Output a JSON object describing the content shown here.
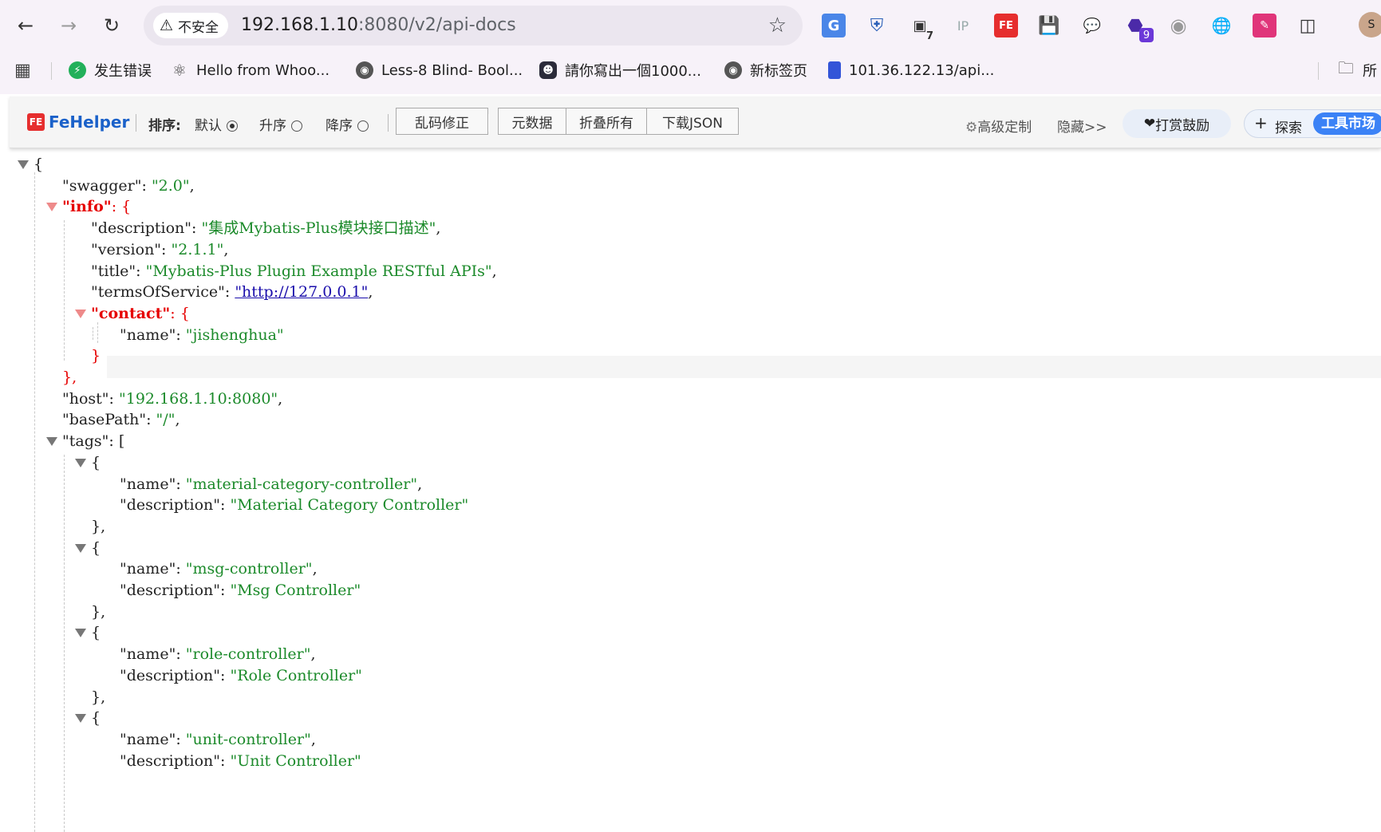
{
  "browser": {
    "security_label": "不安全",
    "url_host": "192.168.1.10",
    "url_rest": ":8080/v2/api-docs",
    "ext_badge_7": "7",
    "ext_badge_9": "9",
    "profile_initial": "S",
    "bookmarks": [
      {
        "label": "发生错误"
      },
      {
        "label": "Hello from Whoo..."
      },
      {
        "label": "Less-8 Blind- Bool..."
      },
      {
        "label": "請你寫出一個1000..."
      },
      {
        "label": "新标签页"
      },
      {
        "label": "101.36.122.13/api..."
      },
      {
        "label": "所"
      }
    ]
  },
  "fehelper": {
    "logo_text": "FeHelper",
    "sort_label": "排序:",
    "sort_default": "默认",
    "sort_asc": "升序",
    "sort_desc": "降序",
    "fix_encoding": "乱码修正",
    "metadata": "元数据",
    "fold_all": "折叠所有",
    "download_json": "下载JSON",
    "advanced": "高级定制",
    "hide": "隐藏>>",
    "donate": "打赏鼓励",
    "explore": "探索",
    "tool_market": "工具市场"
  },
  "json_lines": [
    {
      "p": "{"
    },
    {
      "k": "swagger",
      "v": "2.0",
      "c": ","
    },
    {
      "k": "info",
      "p": "{"
    },
    {
      "k": "description",
      "v": "集成Mybatis-Plus模块接口描述",
      "c": ","
    },
    {
      "k": "version",
      "v": "2.1.1",
      "c": ","
    },
    {
      "k": "title",
      "v": "Mybatis-Plus Plugin Example RESTful APIs",
      "c": ","
    },
    {
      "k": "termsOfService",
      "v": "http://127.0.0.1",
      "c": ","
    },
    {
      "k": "contact",
      "p": "{"
    },
    {
      "k": "name",
      "v": "jishenghua"
    },
    {
      "p": "}"
    },
    {
      "p": "},"
    },
    {
      "k": "host",
      "v": "192.168.1.10:8080",
      "c": ","
    },
    {
      "k": "basePath",
      "v": "/",
      "c": ","
    },
    {
      "k": "tags",
      "p": "["
    },
    {
      "p": "{"
    },
    {
      "k": "name",
      "v": "material-category-controller",
      "c": ","
    },
    {
      "k": "description",
      "v": "Material Category Controller"
    },
    {
      "p": "},"
    },
    {
      "p": "{"
    },
    {
      "k": "name",
      "v": "msg-controller",
      "c": ","
    },
    {
      "k": "description",
      "v": "Msg Controller"
    },
    {
      "p": "},"
    },
    {
      "p": "{"
    },
    {
      "k": "name",
      "v": "role-controller",
      "c": ","
    },
    {
      "k": "description",
      "v": "Role Controller"
    },
    {
      "p": "},"
    },
    {
      "p": "{"
    },
    {
      "k": "name",
      "v": "unit-controller",
      "c": ","
    },
    {
      "k": "description",
      "v": "Unit Controller"
    }
  ]
}
